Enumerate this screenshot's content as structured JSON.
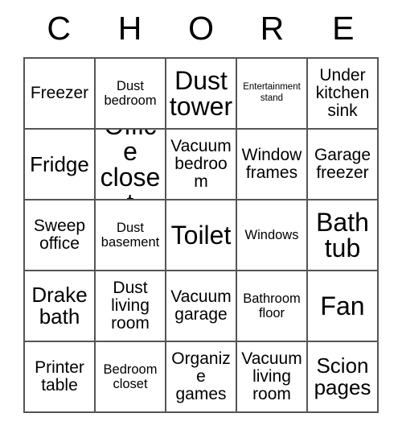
{
  "card": {
    "title_letters": [
      "C",
      "H",
      "O",
      "R",
      "E"
    ],
    "rows": [
      [
        {
          "text": "Freezer",
          "size": "md"
        },
        {
          "text": "Dust bedroom",
          "size": "sm"
        },
        {
          "text": "Dust tower",
          "size": "xl"
        },
        {
          "text": "Entertainment stand",
          "size": "xs"
        },
        {
          "text": "Under kitchen sink",
          "size": "md"
        }
      ],
      [
        {
          "text": "Fridge",
          "size": "lg"
        },
        {
          "text": "Office closet",
          "size": "xl"
        },
        {
          "text": "Vacuum bedroom",
          "size": "md"
        },
        {
          "text": "Window frames",
          "size": "md"
        },
        {
          "text": "Garage freezer",
          "size": "md"
        }
      ],
      [
        {
          "text": "Sweep office",
          "size": "md"
        },
        {
          "text": "Dust basement",
          "size": "sm"
        },
        {
          "text": "Toilet",
          "size": "xl"
        },
        {
          "text": "Windows",
          "size": "sm"
        },
        {
          "text": "Bath tub",
          "size": "xl"
        }
      ],
      [
        {
          "text": "Drake bath",
          "size": "lg"
        },
        {
          "text": "Dust living room",
          "size": "md"
        },
        {
          "text": "Vacuum garage",
          "size": "md"
        },
        {
          "text": "Bathroom floor",
          "size": "sm"
        },
        {
          "text": "Fan",
          "size": "xl"
        }
      ],
      [
        {
          "text": "Printer table",
          "size": "md"
        },
        {
          "text": "Bedroom closet",
          "size": "sm"
        },
        {
          "text": "Organize games",
          "size": "md"
        },
        {
          "text": "Vacuum living room",
          "size": "md"
        },
        {
          "text": "Scion pages",
          "size": "lg"
        }
      ]
    ]
  }
}
